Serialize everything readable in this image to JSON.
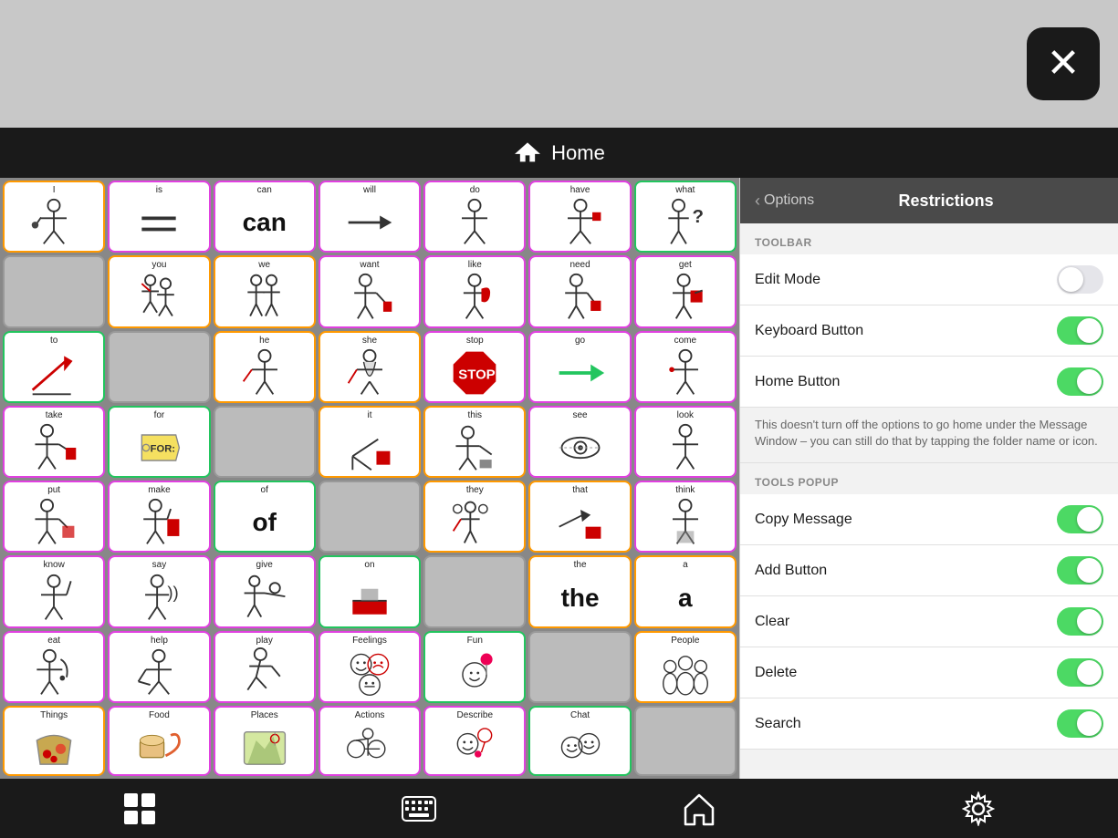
{
  "topBar": {
    "closeButton": "×"
  },
  "header": {
    "title": "Home",
    "homeIconLabel": "home-icon"
  },
  "panel": {
    "backLabel": "Options",
    "title": "Restrictions",
    "toolbarSection": "TOOLBAR",
    "toolsPopupSection": "TOOLS POPUP",
    "rows": [
      {
        "id": "edit-mode",
        "label": "Edit Mode",
        "toggle": "off"
      },
      {
        "id": "keyboard-button",
        "label": "Keyboard Button",
        "toggle": "on"
      },
      {
        "id": "home-button",
        "label": "Home Button",
        "toggle": "on"
      },
      {
        "id": "copy-message",
        "label": "Copy Message",
        "toggle": "on"
      },
      {
        "id": "add-button",
        "label": "Add Button",
        "toggle": "on"
      },
      {
        "id": "clear",
        "label": "Clear",
        "toggle": "on"
      },
      {
        "id": "delete",
        "label": "Delete",
        "toggle": "on"
      },
      {
        "id": "search",
        "label": "Search",
        "toggle": "on"
      }
    ],
    "homeNote": "This doesn't turn off the options to go home under the Message Window – you can still do that by tapping the folder name or icon."
  },
  "grid": {
    "cells": [
      {
        "label": "I",
        "type": "figure",
        "border": "orange"
      },
      {
        "label": "is",
        "type": "equals",
        "border": "pink"
      },
      {
        "label": "can",
        "type": "bigtext",
        "text": "can",
        "border": "pink"
      },
      {
        "label": "will",
        "type": "arrow-right",
        "border": "pink"
      },
      {
        "label": "do",
        "type": "figure",
        "border": "pink"
      },
      {
        "label": "have",
        "type": "figure",
        "border": "pink"
      },
      {
        "label": "what",
        "type": "figure-question",
        "border": "green"
      },
      {
        "label": "",
        "type": "hidden",
        "border": "gray"
      },
      {
        "label": "you",
        "type": "figure",
        "border": "orange"
      },
      {
        "label": "we",
        "type": "figure",
        "border": "orange"
      },
      {
        "label": "want",
        "type": "figure",
        "border": "pink"
      },
      {
        "label": "like",
        "type": "figure",
        "border": "pink"
      },
      {
        "label": "need",
        "type": "figure",
        "border": "pink"
      },
      {
        "label": "get",
        "type": "figure",
        "border": "pink"
      },
      {
        "label": "to",
        "type": "arrow-diag",
        "border": "green"
      },
      {
        "label": "",
        "type": "hidden",
        "border": "gray"
      },
      {
        "label": "he",
        "type": "figure",
        "border": "orange"
      },
      {
        "label": "she",
        "type": "figure",
        "border": "orange"
      },
      {
        "label": "stop",
        "type": "stop-sign",
        "border": "pink"
      },
      {
        "label": "go",
        "type": "arrow-right-green",
        "border": "pink"
      },
      {
        "label": "come",
        "type": "figure",
        "border": "pink"
      },
      {
        "label": "take",
        "type": "figure",
        "border": "pink"
      },
      {
        "label": "for",
        "type": "tag",
        "border": "green"
      },
      {
        "label": "",
        "type": "hidden",
        "border": "gray"
      },
      {
        "label": "it",
        "type": "figure-box",
        "border": "orange"
      },
      {
        "label": "this",
        "type": "figure-point",
        "border": "orange"
      },
      {
        "label": "see",
        "type": "eye",
        "border": "pink"
      },
      {
        "label": "look",
        "type": "figure",
        "border": "pink"
      },
      {
        "label": "put",
        "type": "figure",
        "border": "pink"
      },
      {
        "label": "make",
        "type": "figure",
        "border": "pink"
      },
      {
        "label": "of",
        "type": "bigtext",
        "text": "of",
        "border": "green"
      },
      {
        "label": "",
        "type": "hidden",
        "border": "gray"
      },
      {
        "label": "they",
        "type": "figure-group",
        "border": "orange"
      },
      {
        "label": "that",
        "type": "figure-point2",
        "border": "orange"
      },
      {
        "label": "think",
        "type": "figure",
        "border": "pink"
      },
      {
        "label": "know",
        "type": "figure",
        "border": "pink"
      },
      {
        "label": "say",
        "type": "figure-speak",
        "border": "pink"
      },
      {
        "label": "give",
        "type": "figure",
        "border": "pink"
      },
      {
        "label": "on",
        "type": "box-top",
        "border": "green"
      },
      {
        "label": "",
        "type": "hidden",
        "border": "gray"
      },
      {
        "label": "the",
        "type": "bigtext",
        "text": "the",
        "border": "orange"
      },
      {
        "label": "a",
        "type": "bigtext",
        "text": "a",
        "border": "orange"
      },
      {
        "label": "eat",
        "type": "figure",
        "border": "pink"
      },
      {
        "label": "help",
        "type": "figure",
        "border": "pink"
      },
      {
        "label": "play",
        "type": "figure",
        "border": "pink"
      },
      {
        "label": "Feelings",
        "type": "faces",
        "border": "pink"
      },
      {
        "label": "Fun",
        "type": "balloon",
        "border": "green"
      },
      {
        "label": "",
        "type": "hidden",
        "border": "gray"
      },
      {
        "label": "People",
        "type": "people-group",
        "border": "orange"
      },
      {
        "label": "Things",
        "type": "basket",
        "border": "orange"
      },
      {
        "label": "Food",
        "type": "food",
        "border": "pink"
      },
      {
        "label": "Places",
        "type": "map",
        "border": "pink"
      },
      {
        "label": "Actions",
        "type": "bike",
        "border": "pink"
      },
      {
        "label": "Describe",
        "type": "describe",
        "border": "pink"
      },
      {
        "label": "Chat",
        "type": "chat-faces",
        "border": "green"
      },
      {
        "label": "",
        "type": "hidden",
        "border": "gray"
      }
    ]
  },
  "bottomToolbar": {
    "gridBtn": "grid-icon",
    "keyboardBtn": "keyboard-icon",
    "homeBtn": "home-icon",
    "settingsBtn": "settings-icon"
  }
}
